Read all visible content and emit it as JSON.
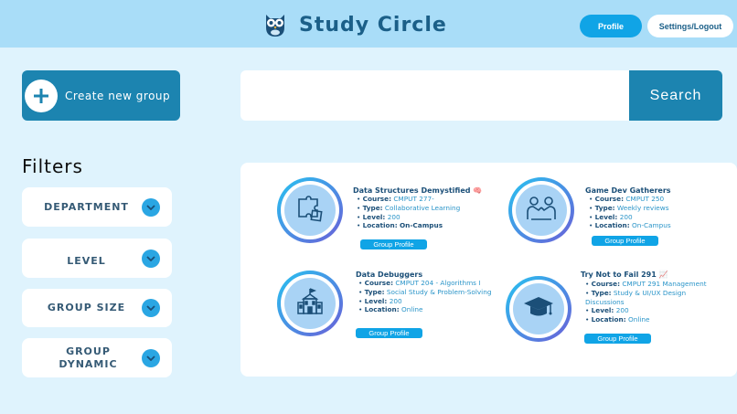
{
  "header": {
    "title": "Study Circle",
    "profile_label": "Profile",
    "settings_label": "Settings/Logout"
  },
  "create_group_label": "Create new group",
  "search": {
    "placeholder": "",
    "button_label": "Search"
  },
  "filters": {
    "title": "Filters",
    "items": [
      {
        "label": "DEPARTMENT"
      },
      {
        "label": "LEVEL"
      },
      {
        "label": "GROUP SIZE"
      },
      {
        "label": "GROUP DYNAMIC"
      }
    ]
  },
  "groups": [
    {
      "title": "Data Structures Demystified 🧠",
      "icon": "puzzle-icon",
      "fields": [
        {
          "key": "Course:",
          "value": "CMPUT 277-"
        },
        {
          "key": "Type:",
          "value": "Collaborative Learning"
        },
        {
          "key": "Level:",
          "value": "200"
        },
        {
          "key": "Location:",
          "value": "On-Campus"
        }
      ],
      "button": "Group Profile"
    },
    {
      "title": "Game Dev Gatherers",
      "icon": "handshake-icon",
      "fields": [
        {
          "key": "Course:",
          "value": "CMPUT 250"
        },
        {
          "key": "Type:",
          "value": "Weekly reviews"
        },
        {
          "key": "Level:",
          "value": "200"
        },
        {
          "key": "Location:",
          "value": "On-Campus"
        }
      ],
      "button": "Group Profile"
    },
    {
      "title": "Data Debuggers",
      "icon": "school-building-icon",
      "fields": [
        {
          "key": "Course:",
          "value": "CMPUT 204 - Algorithms I"
        },
        {
          "key": "Type:",
          "value": "Social Study & Problem-Solving"
        },
        {
          "key": "Level:",
          "value": "200"
        },
        {
          "key": "Location:",
          "value": "Online"
        }
      ],
      "button": "Group Profile"
    },
    {
      "title": "Try Not to Fail 291 📈",
      "icon": "graduation-cap-icon",
      "fields": [
        {
          "key": "Course:",
          "value": "CMPUT 291 Management"
        },
        {
          "key": "Type:",
          "value": "Study & UI/UX Design Discussions"
        },
        {
          "key": "Level:",
          "value": "200"
        },
        {
          "key": "Location:",
          "value": "Online"
        }
      ],
      "button": "Group Profile"
    }
  ],
  "colors": {
    "header_bg": "#a9ddf8",
    "page_bg": "#dff3fd",
    "accent": "#1c84b0",
    "button_blue": "#10a4e6",
    "title_blue": "#1b5f88"
  }
}
